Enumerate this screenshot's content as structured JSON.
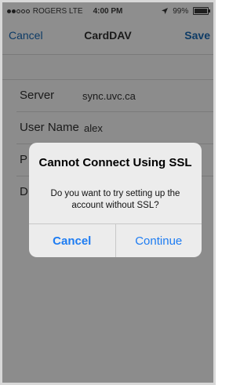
{
  "status_bar": {
    "carrier": "ROGERS",
    "network": "LTE",
    "time": "4:00 PM",
    "battery": "99%",
    "battery_level": 0.99,
    "signal_bars_filled": 2,
    "signal_bars_total": 5
  },
  "navbar": {
    "cancel_label": "Cancel",
    "title": "CardDAV",
    "save_label": "Save"
  },
  "form": {
    "server_label": "Server",
    "server_value": "sync.uvc.ca",
    "username_label": "User Name",
    "username_value": "alex",
    "password_label_partial": "P",
    "description_label_partial": "D"
  },
  "alert": {
    "title": "Cannot Connect Using SSL",
    "message": "Do you want to try setting up the account without SSL?",
    "cancel_label": "Cancel",
    "continue_label": "Continue"
  },
  "colors": {
    "accent": "#1d7cf2",
    "dimmed_background": "#8c8c8c",
    "alert_background": "#ececec"
  }
}
